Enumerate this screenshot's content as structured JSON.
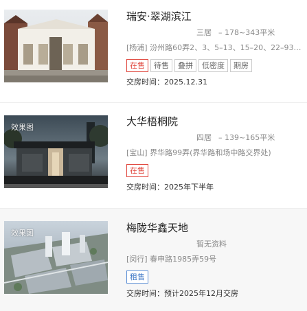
{
  "listings": [
    {
      "name": "瑞安·翠湖滨江",
      "rooms": "三居",
      "area": "– 178~343平米",
      "address": "[杨浦] 汾州路60弄2、3、5–13、15–20、22–93…",
      "tags": [
        "在售",
        "待售",
        "叠拼",
        "低密度",
        "期房"
      ],
      "delivery_label": "交房时间：",
      "delivery_value": "2025.12.31"
    },
    {
      "image_tag": "效果图",
      "name": "大华梧桐院",
      "rooms": "四居",
      "area": "– 139~165平米",
      "address": "[宝山] 界华路99弄(界华路和场中路交界处)",
      "tags": [
        "在售"
      ],
      "delivery_label": "交房时间：",
      "delivery_value": "2025年下半年"
    },
    {
      "image_tag": "效果图",
      "name": "梅陇华鑫天地",
      "rooms": "暂无资料",
      "address": "[闵行] 春申路1985弄59号",
      "tags": [
        "租售"
      ],
      "delivery_label": "交房时间：",
      "delivery_value": "预计2025年12月交房"
    }
  ]
}
